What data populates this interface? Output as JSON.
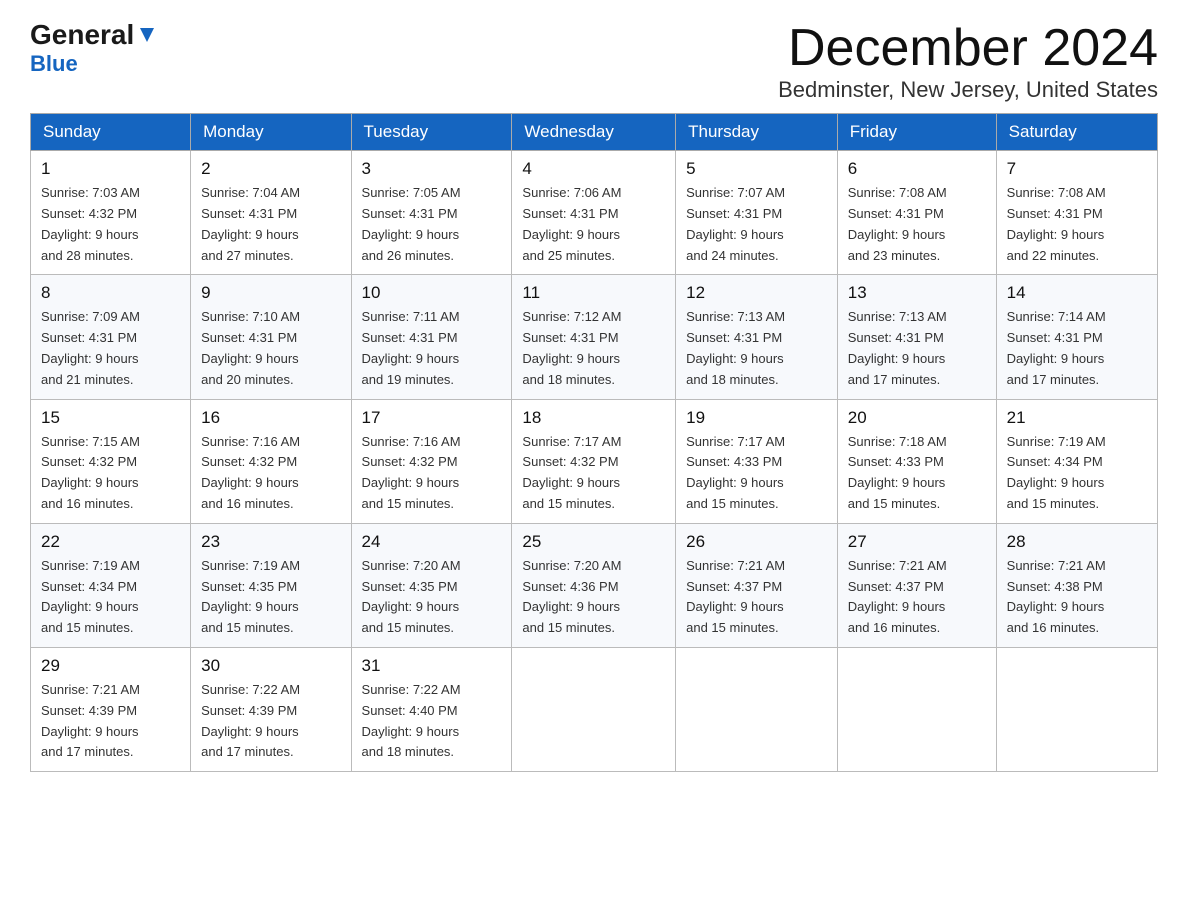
{
  "header": {
    "logo_general": "General",
    "logo_blue": "Blue",
    "month_title": "December 2024",
    "location": "Bedminster, New Jersey, United States"
  },
  "weekdays": [
    "Sunday",
    "Monday",
    "Tuesday",
    "Wednesday",
    "Thursday",
    "Friday",
    "Saturday"
  ],
  "weeks": [
    [
      {
        "day": "1",
        "sunrise": "7:03 AM",
        "sunset": "4:32 PM",
        "daylight": "9 hours and 28 minutes."
      },
      {
        "day": "2",
        "sunrise": "7:04 AM",
        "sunset": "4:31 PM",
        "daylight": "9 hours and 27 minutes."
      },
      {
        "day": "3",
        "sunrise": "7:05 AM",
        "sunset": "4:31 PM",
        "daylight": "9 hours and 26 minutes."
      },
      {
        "day": "4",
        "sunrise": "7:06 AM",
        "sunset": "4:31 PM",
        "daylight": "9 hours and 25 minutes."
      },
      {
        "day": "5",
        "sunrise": "7:07 AM",
        "sunset": "4:31 PM",
        "daylight": "9 hours and 24 minutes."
      },
      {
        "day": "6",
        "sunrise": "7:08 AM",
        "sunset": "4:31 PM",
        "daylight": "9 hours and 23 minutes."
      },
      {
        "day": "7",
        "sunrise": "7:08 AM",
        "sunset": "4:31 PM",
        "daylight": "9 hours and 22 minutes."
      }
    ],
    [
      {
        "day": "8",
        "sunrise": "7:09 AM",
        "sunset": "4:31 PM",
        "daylight": "9 hours and 21 minutes."
      },
      {
        "day": "9",
        "sunrise": "7:10 AM",
        "sunset": "4:31 PM",
        "daylight": "9 hours and 20 minutes."
      },
      {
        "day": "10",
        "sunrise": "7:11 AM",
        "sunset": "4:31 PM",
        "daylight": "9 hours and 19 minutes."
      },
      {
        "day": "11",
        "sunrise": "7:12 AM",
        "sunset": "4:31 PM",
        "daylight": "9 hours and 18 minutes."
      },
      {
        "day": "12",
        "sunrise": "7:13 AM",
        "sunset": "4:31 PM",
        "daylight": "9 hours and 18 minutes."
      },
      {
        "day": "13",
        "sunrise": "7:13 AM",
        "sunset": "4:31 PM",
        "daylight": "9 hours and 17 minutes."
      },
      {
        "day": "14",
        "sunrise": "7:14 AM",
        "sunset": "4:31 PM",
        "daylight": "9 hours and 17 minutes."
      }
    ],
    [
      {
        "day": "15",
        "sunrise": "7:15 AM",
        "sunset": "4:32 PM",
        "daylight": "9 hours and 16 minutes."
      },
      {
        "day": "16",
        "sunrise": "7:16 AM",
        "sunset": "4:32 PM",
        "daylight": "9 hours and 16 minutes."
      },
      {
        "day": "17",
        "sunrise": "7:16 AM",
        "sunset": "4:32 PM",
        "daylight": "9 hours and 15 minutes."
      },
      {
        "day": "18",
        "sunrise": "7:17 AM",
        "sunset": "4:32 PM",
        "daylight": "9 hours and 15 minutes."
      },
      {
        "day": "19",
        "sunrise": "7:17 AM",
        "sunset": "4:33 PM",
        "daylight": "9 hours and 15 minutes."
      },
      {
        "day": "20",
        "sunrise": "7:18 AM",
        "sunset": "4:33 PM",
        "daylight": "9 hours and 15 minutes."
      },
      {
        "day": "21",
        "sunrise": "7:19 AM",
        "sunset": "4:34 PM",
        "daylight": "9 hours and 15 minutes."
      }
    ],
    [
      {
        "day": "22",
        "sunrise": "7:19 AM",
        "sunset": "4:34 PM",
        "daylight": "9 hours and 15 minutes."
      },
      {
        "day": "23",
        "sunrise": "7:19 AM",
        "sunset": "4:35 PM",
        "daylight": "9 hours and 15 minutes."
      },
      {
        "day": "24",
        "sunrise": "7:20 AM",
        "sunset": "4:35 PM",
        "daylight": "9 hours and 15 minutes."
      },
      {
        "day": "25",
        "sunrise": "7:20 AM",
        "sunset": "4:36 PM",
        "daylight": "9 hours and 15 minutes."
      },
      {
        "day": "26",
        "sunrise": "7:21 AM",
        "sunset": "4:37 PM",
        "daylight": "9 hours and 15 minutes."
      },
      {
        "day": "27",
        "sunrise": "7:21 AM",
        "sunset": "4:37 PM",
        "daylight": "9 hours and 16 minutes."
      },
      {
        "day": "28",
        "sunrise": "7:21 AM",
        "sunset": "4:38 PM",
        "daylight": "9 hours and 16 minutes."
      }
    ],
    [
      {
        "day": "29",
        "sunrise": "7:21 AM",
        "sunset": "4:39 PM",
        "daylight": "9 hours and 17 minutes."
      },
      {
        "day": "30",
        "sunrise": "7:22 AM",
        "sunset": "4:39 PM",
        "daylight": "9 hours and 17 minutes."
      },
      {
        "day": "31",
        "sunrise": "7:22 AM",
        "sunset": "4:40 PM",
        "daylight": "9 hours and 18 minutes."
      },
      null,
      null,
      null,
      null
    ]
  ],
  "labels": {
    "sunrise": "Sunrise:",
    "sunset": "Sunset:",
    "daylight": "Daylight:"
  }
}
